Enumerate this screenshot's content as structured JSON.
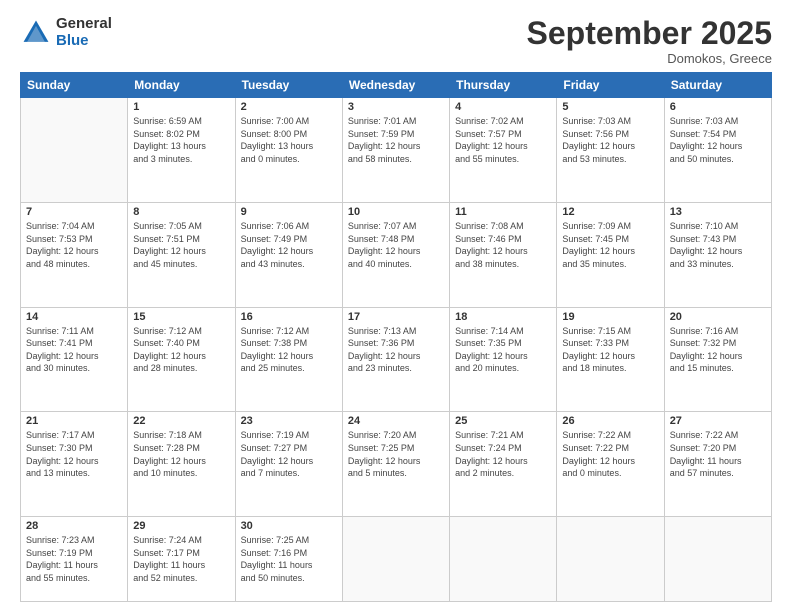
{
  "header": {
    "logo_general": "General",
    "logo_blue": "Blue",
    "month_title": "September 2025",
    "location": "Domokos, Greece"
  },
  "weekdays": [
    "Sunday",
    "Monday",
    "Tuesday",
    "Wednesday",
    "Thursday",
    "Friday",
    "Saturday"
  ],
  "weeks": [
    [
      {
        "day": "",
        "info": ""
      },
      {
        "day": "1",
        "info": "Sunrise: 6:59 AM\nSunset: 8:02 PM\nDaylight: 13 hours\nand 3 minutes."
      },
      {
        "day": "2",
        "info": "Sunrise: 7:00 AM\nSunset: 8:00 PM\nDaylight: 13 hours\nand 0 minutes."
      },
      {
        "day": "3",
        "info": "Sunrise: 7:01 AM\nSunset: 7:59 PM\nDaylight: 12 hours\nand 58 minutes."
      },
      {
        "day": "4",
        "info": "Sunrise: 7:02 AM\nSunset: 7:57 PM\nDaylight: 12 hours\nand 55 minutes."
      },
      {
        "day": "5",
        "info": "Sunrise: 7:03 AM\nSunset: 7:56 PM\nDaylight: 12 hours\nand 53 minutes."
      },
      {
        "day": "6",
        "info": "Sunrise: 7:03 AM\nSunset: 7:54 PM\nDaylight: 12 hours\nand 50 minutes."
      }
    ],
    [
      {
        "day": "7",
        "info": "Sunrise: 7:04 AM\nSunset: 7:53 PM\nDaylight: 12 hours\nand 48 minutes."
      },
      {
        "day": "8",
        "info": "Sunrise: 7:05 AM\nSunset: 7:51 PM\nDaylight: 12 hours\nand 45 minutes."
      },
      {
        "day": "9",
        "info": "Sunrise: 7:06 AM\nSunset: 7:49 PM\nDaylight: 12 hours\nand 43 minutes."
      },
      {
        "day": "10",
        "info": "Sunrise: 7:07 AM\nSunset: 7:48 PM\nDaylight: 12 hours\nand 40 minutes."
      },
      {
        "day": "11",
        "info": "Sunrise: 7:08 AM\nSunset: 7:46 PM\nDaylight: 12 hours\nand 38 minutes."
      },
      {
        "day": "12",
        "info": "Sunrise: 7:09 AM\nSunset: 7:45 PM\nDaylight: 12 hours\nand 35 minutes."
      },
      {
        "day": "13",
        "info": "Sunrise: 7:10 AM\nSunset: 7:43 PM\nDaylight: 12 hours\nand 33 minutes."
      }
    ],
    [
      {
        "day": "14",
        "info": "Sunrise: 7:11 AM\nSunset: 7:41 PM\nDaylight: 12 hours\nand 30 minutes."
      },
      {
        "day": "15",
        "info": "Sunrise: 7:12 AM\nSunset: 7:40 PM\nDaylight: 12 hours\nand 28 minutes."
      },
      {
        "day": "16",
        "info": "Sunrise: 7:12 AM\nSunset: 7:38 PM\nDaylight: 12 hours\nand 25 minutes."
      },
      {
        "day": "17",
        "info": "Sunrise: 7:13 AM\nSunset: 7:36 PM\nDaylight: 12 hours\nand 23 minutes."
      },
      {
        "day": "18",
        "info": "Sunrise: 7:14 AM\nSunset: 7:35 PM\nDaylight: 12 hours\nand 20 minutes."
      },
      {
        "day": "19",
        "info": "Sunrise: 7:15 AM\nSunset: 7:33 PM\nDaylight: 12 hours\nand 18 minutes."
      },
      {
        "day": "20",
        "info": "Sunrise: 7:16 AM\nSunset: 7:32 PM\nDaylight: 12 hours\nand 15 minutes."
      }
    ],
    [
      {
        "day": "21",
        "info": "Sunrise: 7:17 AM\nSunset: 7:30 PM\nDaylight: 12 hours\nand 13 minutes."
      },
      {
        "day": "22",
        "info": "Sunrise: 7:18 AM\nSunset: 7:28 PM\nDaylight: 12 hours\nand 10 minutes."
      },
      {
        "day": "23",
        "info": "Sunrise: 7:19 AM\nSunset: 7:27 PM\nDaylight: 12 hours\nand 7 minutes."
      },
      {
        "day": "24",
        "info": "Sunrise: 7:20 AM\nSunset: 7:25 PM\nDaylight: 12 hours\nand 5 minutes."
      },
      {
        "day": "25",
        "info": "Sunrise: 7:21 AM\nSunset: 7:24 PM\nDaylight: 12 hours\nand 2 minutes."
      },
      {
        "day": "26",
        "info": "Sunrise: 7:22 AM\nSunset: 7:22 PM\nDaylight: 12 hours\nand 0 minutes."
      },
      {
        "day": "27",
        "info": "Sunrise: 7:22 AM\nSunset: 7:20 PM\nDaylight: 11 hours\nand 57 minutes."
      }
    ],
    [
      {
        "day": "28",
        "info": "Sunrise: 7:23 AM\nSunset: 7:19 PM\nDaylight: 11 hours\nand 55 minutes."
      },
      {
        "day": "29",
        "info": "Sunrise: 7:24 AM\nSunset: 7:17 PM\nDaylight: 11 hours\nand 52 minutes."
      },
      {
        "day": "30",
        "info": "Sunrise: 7:25 AM\nSunset: 7:16 PM\nDaylight: 11 hours\nand 50 minutes."
      },
      {
        "day": "",
        "info": ""
      },
      {
        "day": "",
        "info": ""
      },
      {
        "day": "",
        "info": ""
      },
      {
        "day": "",
        "info": ""
      }
    ]
  ]
}
